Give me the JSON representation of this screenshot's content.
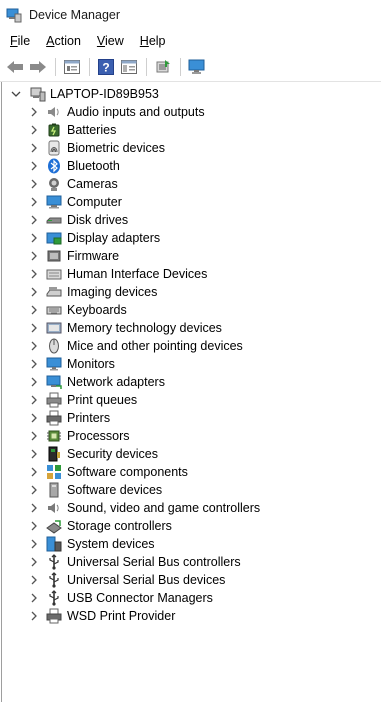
{
  "window": {
    "title": "Device Manager"
  },
  "menu": [
    {
      "label": "File",
      "accel": "F",
      "rest": "ile"
    },
    {
      "label": "Action",
      "accel": "A",
      "rest": "ction"
    },
    {
      "label": "View",
      "accel": "V",
      "rest": "iew"
    },
    {
      "label": "Help",
      "accel": "H",
      "rest": "elp"
    }
  ],
  "toolbar": {
    "buttons": [
      "back-icon",
      "forward-icon",
      "properties-icon",
      "help-icon",
      "show-hide-console-tree-icon",
      "update-driver-icon",
      "scan-hardware-icon"
    ]
  },
  "tree": {
    "root": {
      "label": "LAPTOP-ID89B953",
      "expanded": true
    },
    "items": [
      {
        "label": "Audio inputs and outputs",
        "icon": "speaker-icon"
      },
      {
        "label": "Batteries",
        "icon": "battery-icon"
      },
      {
        "label": "Biometric devices",
        "icon": "fingerprint-icon"
      },
      {
        "label": "Bluetooth",
        "icon": "bluetooth-icon"
      },
      {
        "label": "Cameras",
        "icon": "camera-icon"
      },
      {
        "label": "Computer",
        "icon": "computer-icon"
      },
      {
        "label": "Disk drives",
        "icon": "disk-drive-icon"
      },
      {
        "label": "Display adapters",
        "icon": "display-adapter-icon"
      },
      {
        "label": "Firmware",
        "icon": "firmware-icon"
      },
      {
        "label": "Human Interface Devices",
        "icon": "hid-icon"
      },
      {
        "label": "Imaging devices",
        "icon": "scanner-icon"
      },
      {
        "label": "Keyboards",
        "icon": "keyboard-icon"
      },
      {
        "label": "Memory technology devices",
        "icon": "memory-icon"
      },
      {
        "label": "Mice and other pointing devices",
        "icon": "mouse-icon"
      },
      {
        "label": "Monitors",
        "icon": "monitor-icon"
      },
      {
        "label": "Network adapters",
        "icon": "network-adapter-icon"
      },
      {
        "label": "Print queues",
        "icon": "print-queue-icon"
      },
      {
        "label": "Printers",
        "icon": "printer-icon"
      },
      {
        "label": "Processors",
        "icon": "processor-icon"
      },
      {
        "label": "Security devices",
        "icon": "security-device-icon"
      },
      {
        "label": "Software components",
        "icon": "software-component-icon"
      },
      {
        "label": "Software devices",
        "icon": "software-device-icon"
      },
      {
        "label": "Sound, video and game controllers",
        "icon": "sound-controller-icon"
      },
      {
        "label": "Storage controllers",
        "icon": "storage-controller-icon"
      },
      {
        "label": "System devices",
        "icon": "system-device-icon"
      },
      {
        "label": "Universal Serial Bus controllers",
        "icon": "usb-icon"
      },
      {
        "label": "Universal Serial Bus devices",
        "icon": "usb-icon"
      },
      {
        "label": "USB Connector Managers",
        "icon": "usb-icon"
      },
      {
        "label": "WSD Print Provider",
        "icon": "printer-icon"
      }
    ]
  }
}
